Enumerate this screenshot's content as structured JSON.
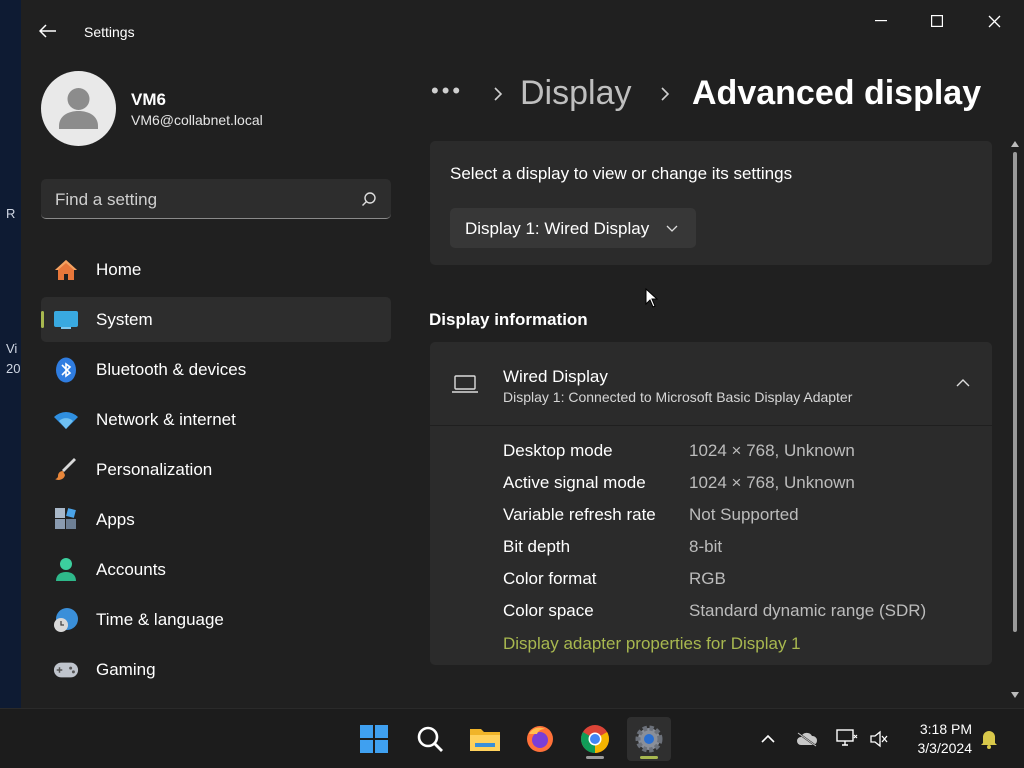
{
  "desktop": {
    "fragments": [
      "R",
      "Vi",
      "20"
    ]
  },
  "window": {
    "title": "Settings",
    "controls": {
      "minimize": "minimize",
      "maximize": "maximize",
      "close": "close"
    }
  },
  "profile": {
    "name": "VM6",
    "email": "VM6@collabnet.local"
  },
  "search": {
    "placeholder": "Find a setting"
  },
  "sidebar": {
    "items": [
      {
        "label": "Home",
        "icon": "home-icon"
      },
      {
        "label": "System",
        "icon": "system-icon",
        "selected": true
      },
      {
        "label": "Bluetooth & devices",
        "icon": "bluetooth-icon"
      },
      {
        "label": "Network & internet",
        "icon": "network-icon"
      },
      {
        "label": "Personalization",
        "icon": "brush-icon"
      },
      {
        "label": "Apps",
        "icon": "apps-icon"
      },
      {
        "label": "Accounts",
        "icon": "accounts-icon"
      },
      {
        "label": "Time & language",
        "icon": "time-language-icon"
      },
      {
        "label": "Gaming",
        "icon": "gaming-icon"
      }
    ]
  },
  "breadcrumb": {
    "overflow": "•••",
    "parent": "Display",
    "current": "Advanced display"
  },
  "select_display": {
    "prompt": "Select a display to view or change its settings",
    "selected": "Display 1: Wired Display"
  },
  "display_info": {
    "section_title": "Display information",
    "name": "Wired Display",
    "subtitle": "Display 1: Connected to Microsoft Basic Display Adapter",
    "rows": [
      {
        "key": "Desktop mode",
        "value": "1024 × 768, Unknown"
      },
      {
        "key": "Active signal mode",
        "value": "1024 × 768, Unknown"
      },
      {
        "key": "Variable refresh rate",
        "value": "Not Supported"
      },
      {
        "key": "Bit depth",
        "value": "8-bit"
      },
      {
        "key": "Color format",
        "value": "RGB"
      },
      {
        "key": "Color space",
        "value": "Standard dynamic range (SDR)"
      }
    ],
    "link": "Display adapter properties for Display 1"
  },
  "colors": {
    "accent": "#a8b84f",
    "window_bg": "#202020",
    "card_bg": "#2b2b2b"
  },
  "taskbar": {
    "apps": [
      "start-icon",
      "search-icon",
      "file-explorer-icon",
      "firefox-icon",
      "chrome-icon",
      "settings-icon"
    ],
    "tray": [
      "chevron-up-icon",
      "onedrive-icon",
      "network-icon",
      "volume-icon",
      "notification-bell-icon"
    ],
    "time": "3:18 PM",
    "date": "3/3/2024"
  }
}
